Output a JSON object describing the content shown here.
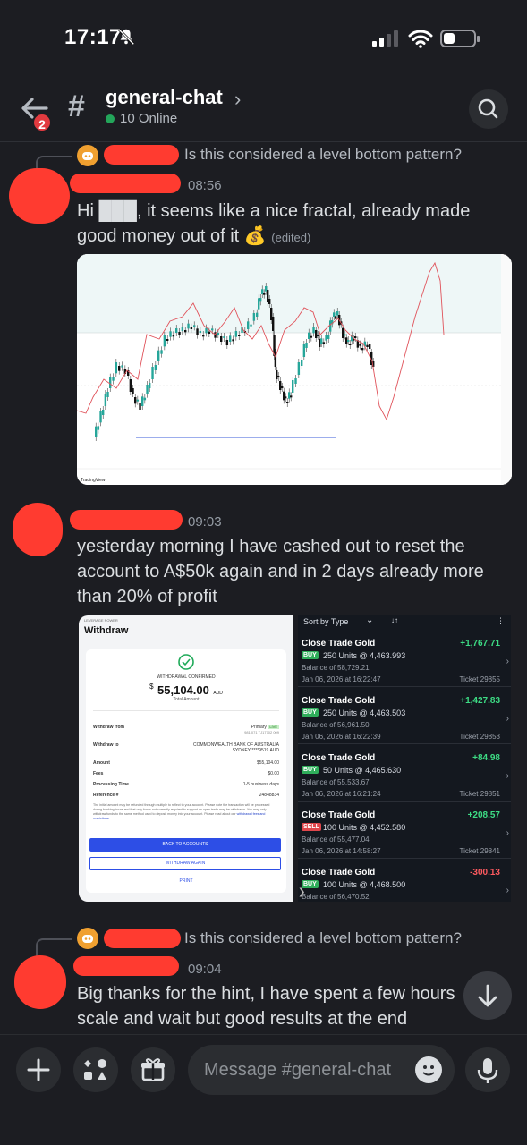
{
  "status_bar": {
    "time": "17:17"
  },
  "header": {
    "channel": "general-chat",
    "online": "10 Online",
    "unread_badge": "2"
  },
  "messages": [
    {
      "reply_text": "Is this considered a level bottom pattern?",
      "timestamp": "08:56",
      "text": "Hi ███, it seems like a nice fractal, already made good money out of it",
      "emoji": "💰",
      "edited": "(edited)"
    },
    {
      "timestamp": "09:03",
      "text": "yesterday morning I have cashed out to reset the account to A$50k again and in 2 days already more than 20% of profit"
    },
    {
      "reply_text": "Is this considered a level bottom pattern?",
      "timestamp": "09:04",
      "text": "Big thanks for the hint, I have spent a few hours scale and wait but good results at the end"
    }
  ],
  "withdraw": {
    "org": "LEVERAGE POWER",
    "title": "Withdraw",
    "confirmed": "WITHDRAWAL CONFIRMED",
    "currency_symbol": "$",
    "amount": "55,104.00",
    "currency": "AUD",
    "amount_label": "Total Amount",
    "rows": [
      {
        "k": "Withdraw from",
        "v": "Primary",
        "tag": "LIVE",
        "sub": "981 071 TJ17702 009"
      },
      {
        "k": "Withdraw to",
        "v": "COMMONWEALTH BANK OF AUSTRALIA",
        "sub": "SYDNEY ****9519 AUD"
      },
      {
        "k": "Amount",
        "v": "$55,104.00"
      },
      {
        "k": "Fees",
        "v": "$0.00"
      },
      {
        "k": "Processing Time",
        "v": "1-5 business days"
      },
      {
        "k": "Reference #",
        "v": "24848834"
      }
    ],
    "note": "The initial amount may be refunded through multiple to reflect to your account. Please note the transaction will be processed during banking hours and that only funds not currently required to support an open trade may be withdrawn. You may only withdraw funds to the same method used to deposit money into your account. Please read about our",
    "note_link": "withdrawal fees and restrictions.",
    "back_button": "BACK TO ACCOUNTS",
    "again_button": "WITHDRAW AGAIN",
    "print": "PRINT"
  },
  "trades": {
    "sort_label": "Sort by Type",
    "items": [
      {
        "title": "Close Trade Gold",
        "profit": "+1,767.71",
        "side": "BUY",
        "units": "250 Units @ 4,463.993",
        "balance": "Balance of 58,729.21",
        "date": "Jan 06, 2026 at 16:22:47",
        "ticket": "Ticket 29855"
      },
      {
        "title": "Close Trade Gold",
        "profit": "+1,427.83",
        "side": "BUY",
        "units": "250 Units @ 4,463.503",
        "balance": "Balance of 56,961.50",
        "date": "Jan 06, 2026 at 16:22:39",
        "ticket": "Ticket 29853"
      },
      {
        "title": "Close Trade Gold",
        "profit": "+84.98",
        "side": "BUY",
        "units": "50 Units @ 4,465.630",
        "balance": "Balance of 55,533.67",
        "date": "Jan 06, 2026 at 16:21:24",
        "ticket": "Ticket 29851"
      },
      {
        "title": "Close Trade Gold",
        "profit": "+208.57",
        "side": "SELL",
        "units": "100 Units @ 4,452.580",
        "balance": "Balance of 55,477.04",
        "date": "Jan 06, 2026 at 14:58:27",
        "ticket": "Ticket 29841"
      },
      {
        "title": "Close Trade Gold",
        "profit": "-300.13",
        "side": "BUY",
        "units": "100 Units @ 4,468.500",
        "balance": "Balance of 56,470.52",
        "date": "",
        "ticket": ""
      }
    ]
  },
  "chart_image": {
    "watermark": "TradingView"
  },
  "composer": {
    "placeholder": "Message #general-chat"
  },
  "colors": {
    "background": "#1c1d22",
    "positive": "#3ddc84",
    "negative": "#ff5a5f",
    "online": "#23a55a",
    "badge": "#e23a3f"
  }
}
